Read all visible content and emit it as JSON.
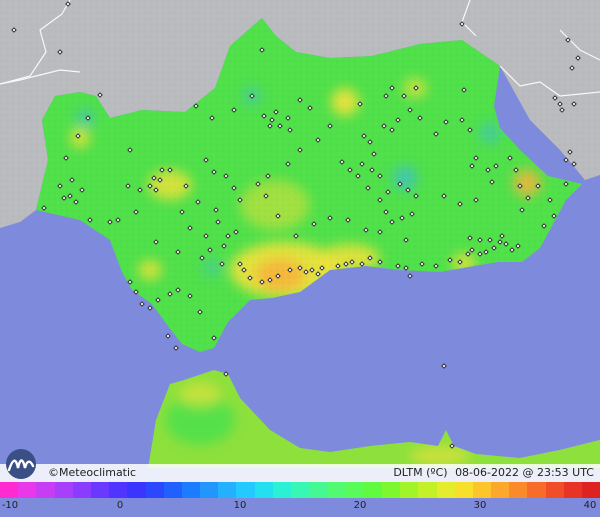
{
  "map": {
    "brand": "©Meteoclimatic",
    "variable": "DLTM (ºC)",
    "datetime": "08-06-2022 @ 23:53 UTC",
    "colors": {
      "sea": "#7e8bdc",
      "land_outside": "#b9bbbe",
      "land_base": "#4fe04a",
      "warm_spot": "#f2e23a",
      "hot_spot": "#f6b43c",
      "cool_spot": "#3fc0c8",
      "station_marker": "#222222"
    }
  },
  "legend": {
    "min": -10,
    "max": 40,
    "ticks": [
      "-10",
      "0",
      "10",
      "20",
      "30",
      "40"
    ],
    "colors": [
      "#ff2bd0",
      "#e838ea",
      "#c63df4",
      "#a83ffa",
      "#8a3cff",
      "#6a38ff",
      "#4f35ff",
      "#3a36ff",
      "#2c48ff",
      "#2060ff",
      "#1b7cff",
      "#2296ff",
      "#22b0ff",
      "#22caff",
      "#22e0f0",
      "#2af0d4",
      "#38f6b4",
      "#46f892",
      "#52fa72",
      "#58fb58",
      "#60fb40",
      "#7ef82e",
      "#a0f428",
      "#c4f02a",
      "#e4ec2c",
      "#f6e02c",
      "#fcc52c",
      "#fca82c",
      "#fa8a2a",
      "#f66c28",
      "#f04e26",
      "#e83424",
      "#de2222"
    ]
  }
}
